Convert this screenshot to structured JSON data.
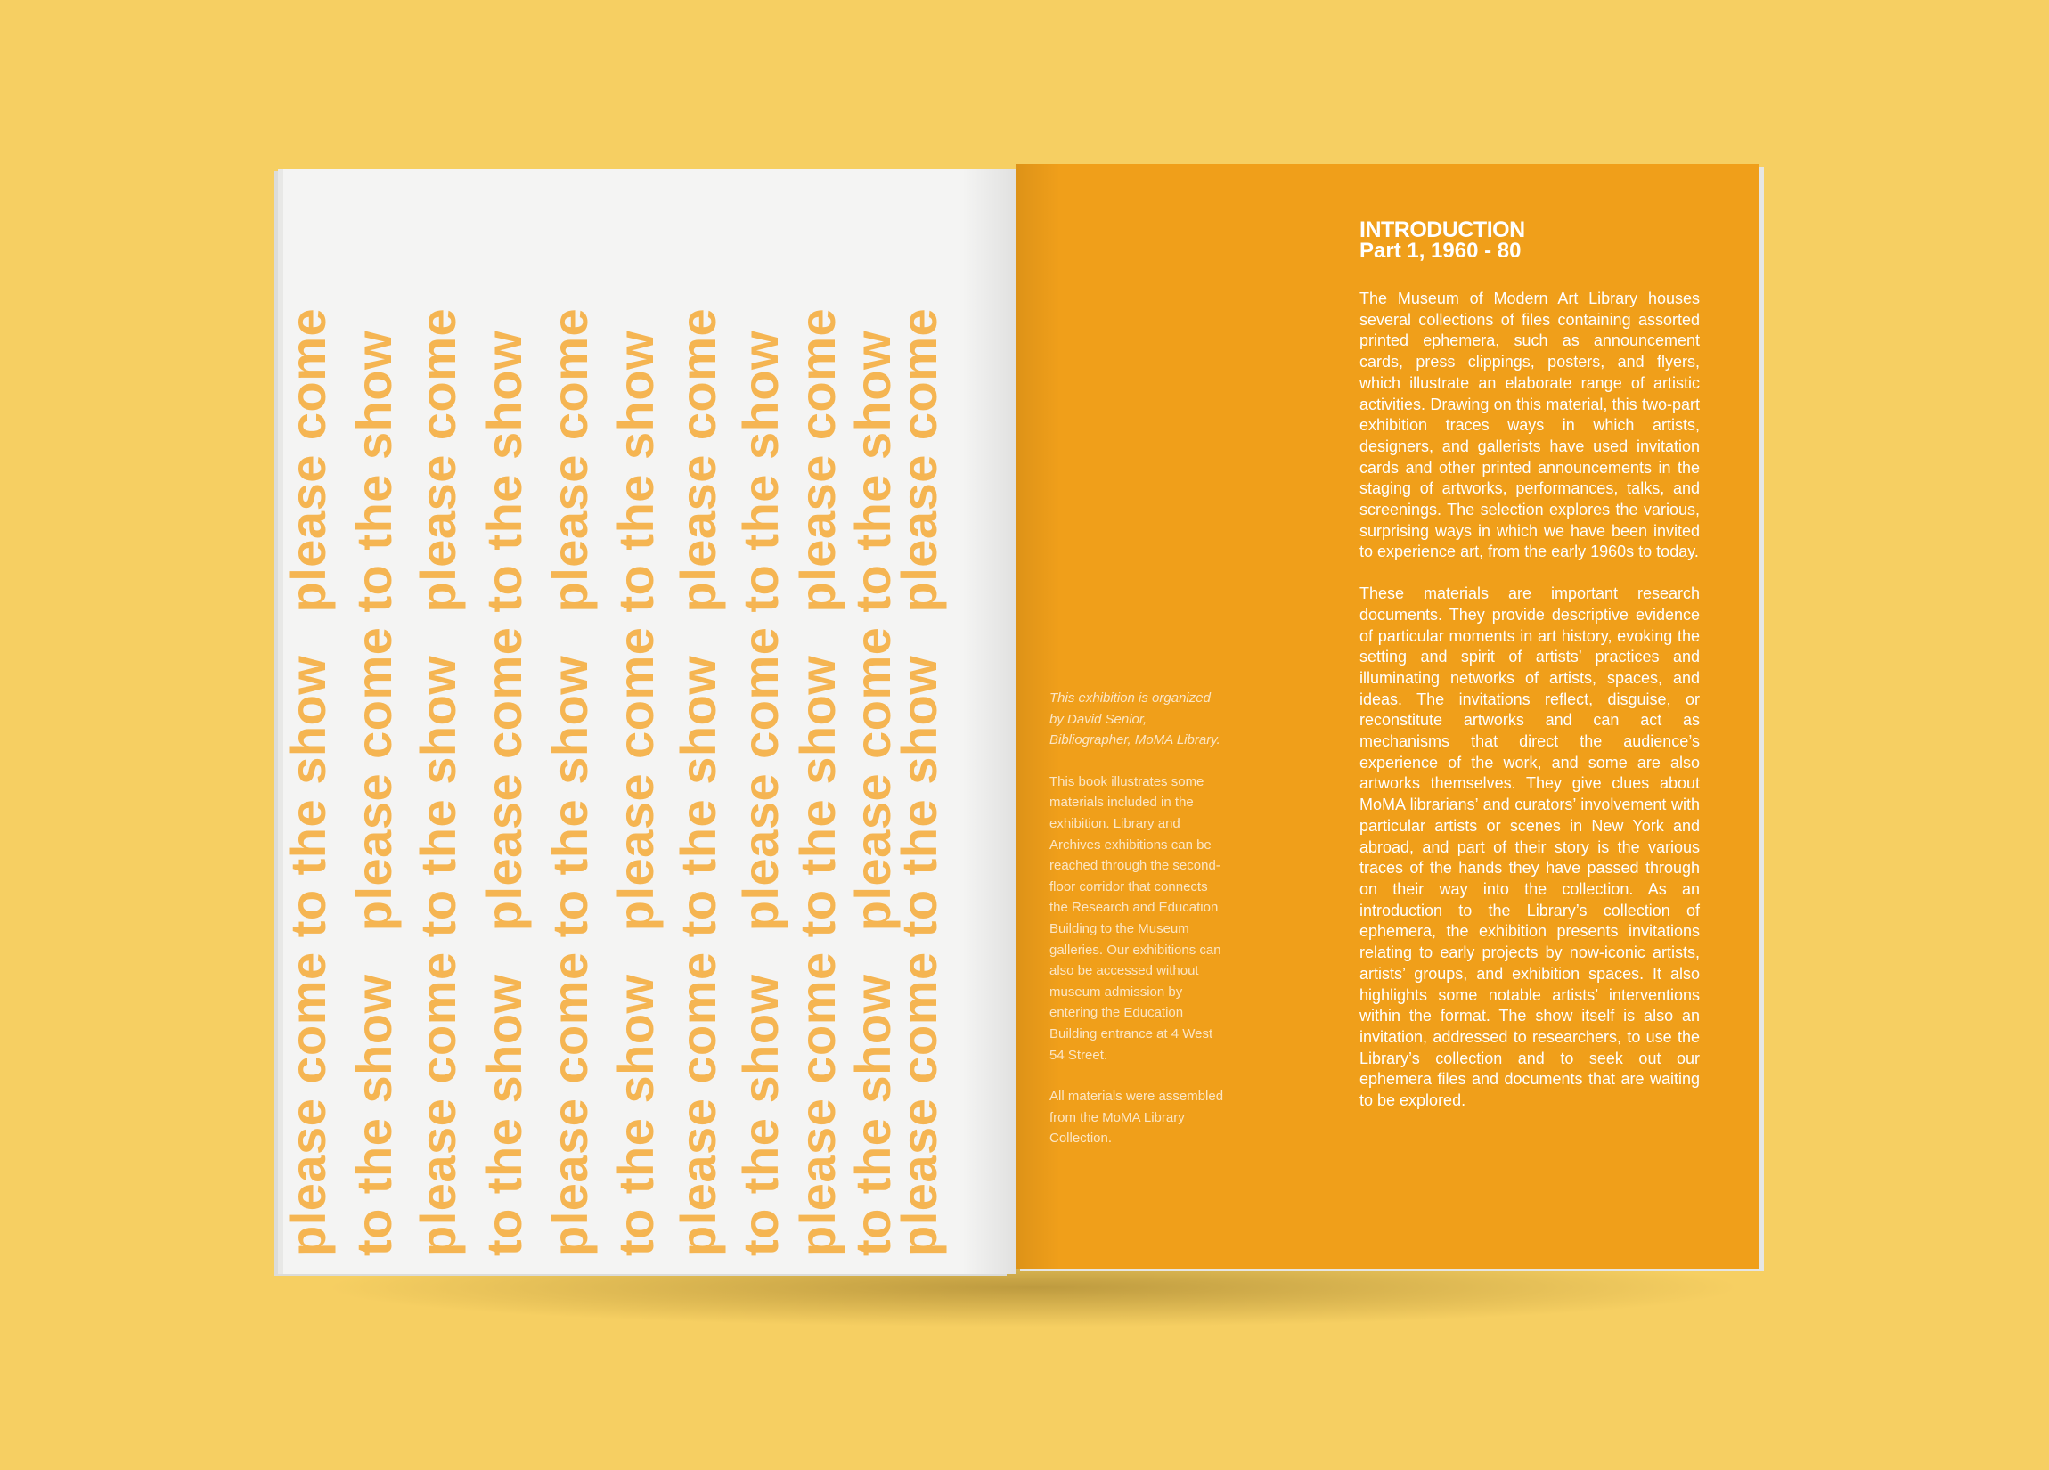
{
  "left_page": {
    "columns": [
      "please come to the show   please come",
      "to the show   please come to the show",
      "please come to the show   please come",
      "to the show   please come to the show",
      "please come to the show   please come",
      "to the show   please come to the show",
      "please come to the show   please come",
      "to the show   please come to the show",
      "please come to the show   please come",
      "to the show   please come to the show",
      "please come to the show   please come"
    ]
  },
  "right_page": {
    "side_notes": [
      "This exhibition is organized by David Senior, Bibliographer, MoMA Library.",
      "This book illustrates some materials included in the exhibition. Library and Archives exhibitions can be reached through the second-floor corridor that connects the Research and Education Building to the Museum galleries. Our exhibitions can also be accessed without museum admission by entering the Education Building entrance at 4 West 54 Street.",
      "All materials were assembled from the MoMA Library Collection."
    ],
    "title": "INTRODUCTION",
    "subtitle": "Part 1, 1960 - 80",
    "paragraphs": [
      "The Museum of Modern Art Library houses several collections of files containing assorted printed ephemera, such as announcement cards, press clippings, posters, and flyers, which illustrate an elaborate range of artistic activities. Drawing on this material, this two-part exhibition traces ways in which artists, designers, and gallerists have used invitation cards and other printed announcements in the staging of artworks, performances, talks, and screenings. The selection explores the various, surprising ways in which we have been invited to experience art, from the early 1960s to today.",
      "These materials are important research documents. They provide descriptive evidence of particular moments in art history, evoking the setting and spirit of artists’ practices and illuminating networks of artists, spaces, and ideas. The invitations reflect, disguise, or reconstitute artworks and can act as mechanisms that direct the audience’s experience of the work, and some are also artworks themselves. They give clues about MoMA librarians’ and curators’ involvement with particular artists or scenes in New York and abroad, and part of their story is the various traces of the hands they have passed through on their way into the collection. As an introduction to the Library’s collection of ephemera, the exhibition presents invitations relating to early projects by now-iconic artists, artists’ groups, and exhibition spaces. It also highlights some notable artists’ interventions within the format. The show itself is also an invitation, addressed to researchers, to use the Library’s collection and to seek out our ephemera files and documents that are waiting to be explored."
    ]
  },
  "colors": {
    "background": "#f6cf62",
    "orange_page": "#f09f1a",
    "left_page": "#f4f4f3",
    "pattern_text": "#f5b552"
  }
}
